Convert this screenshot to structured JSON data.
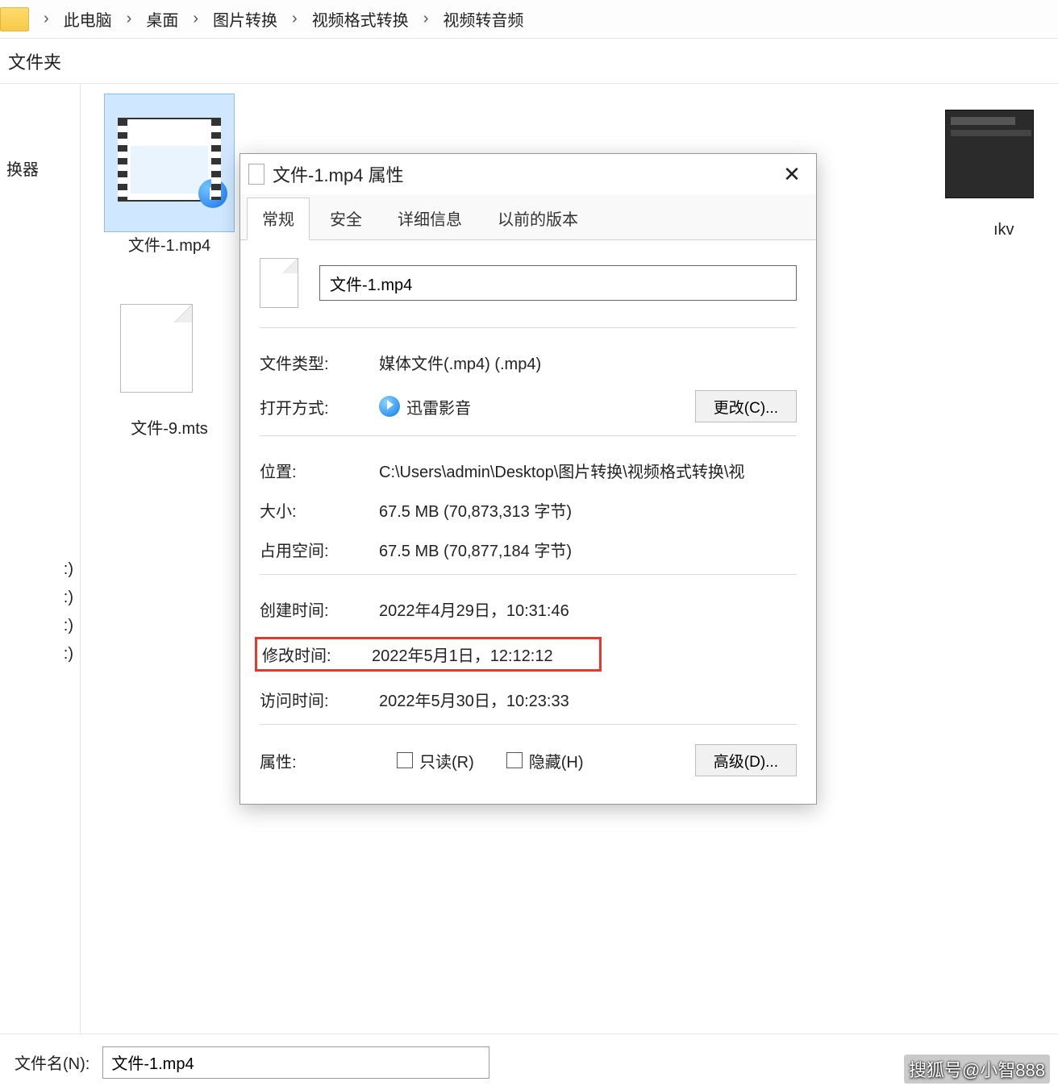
{
  "breadcrumb": {
    "items": [
      "此电脑",
      "桌面",
      "图片转换",
      "视频格式转换",
      "视频转音频"
    ]
  },
  "toolbar": {
    "new_folder_label": "文件夹"
  },
  "sidebar": {
    "item0": "换器",
    "mark1": ":)",
    "mark2": ":)",
    "mark3": ":)",
    "mark4": ":)"
  },
  "files": {
    "selected": {
      "name": "文件-1.mp4"
    },
    "item2": {
      "name": "文件-9.mts"
    },
    "item3": {
      "name": "ıkv"
    }
  },
  "filebar": {
    "label": "文件名(N):",
    "value": "文件-1.mp4"
  },
  "dialog": {
    "title": "文件-1.mp4 属性",
    "tabs": {
      "general": "常规",
      "security": "安全",
      "details": "详细信息",
      "previous": "以前的版本"
    },
    "filename": "文件-1.mp4",
    "type_label": "文件类型:",
    "type_value": "媒体文件(.mp4) (.mp4)",
    "open_label": "打开方式:",
    "open_app": "迅雷影音",
    "change_btn": "更改(C)...",
    "loc_label": "位置:",
    "loc_value": "C:\\Users\\admin\\Desktop\\图片转换\\视频格式转换\\视",
    "size_label": "大小:",
    "size_value": "67.5 MB (70,873,313 字节)",
    "disk_label": "占用空间:",
    "disk_value": "67.5 MB (70,877,184 字节)",
    "created_label": "创建时间:",
    "created_value": "2022年4月29日，10:31:46",
    "modified_label": "修改时间:",
    "modified_value": "2022年5月1日，12:12:12",
    "accessed_label": "访问时间:",
    "accessed_value": "2022年5月30日，10:23:33",
    "attr_label": "属性:",
    "readonly_label": "只读(R)",
    "hidden_label": "隐藏(H)",
    "advanced_btn": "高级(D)..."
  },
  "watermark": "搜狐号@小智888"
}
